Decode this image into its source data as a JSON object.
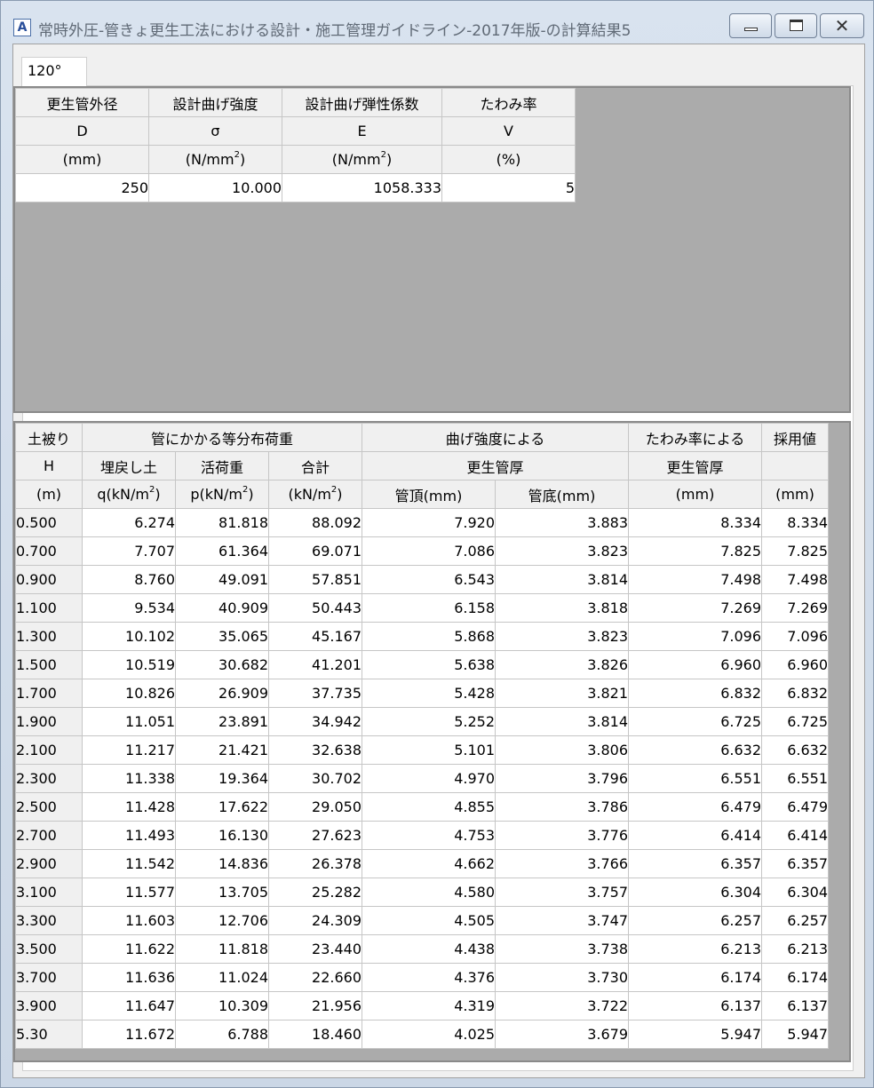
{
  "window": {
    "title": "常時外圧-管きょ更生工法における設計・施工管理ガイドライン-2017年版-の計算結果5",
    "icon": "app-a-icon",
    "close_glyph": "✕"
  },
  "tab": {
    "label": "120°"
  },
  "params": {
    "headers": [
      {
        "l1": "更生管外径",
        "l2": "D",
        "l3": "(mm)"
      },
      {
        "l1": "設計曲げ強度",
        "l2": "σ",
        "l3": "(N/mm²)"
      },
      {
        "l1": "設計曲げ弾性係数",
        "l2": "E",
        "l3": "(N/mm²)"
      },
      {
        "l1": "たわみ率",
        "l2": "V",
        "l3": "(%)"
      }
    ],
    "values": [
      "250",
      "10.000",
      "1058.333",
      "5"
    ]
  },
  "results": {
    "header": {
      "cover_l1": "土被り",
      "cover_l2": "H",
      "cover_l3": "(m)",
      "load_group": "管にかかる等分布荷重",
      "q_l1": "埋戻し土",
      "q_l2": "q(kN/m²)",
      "p_l1": "活荷重",
      "p_l2": "p(kN/m²)",
      "sum_l1": "合計",
      "sum_l2": "(kN/m²)",
      "bend_l1": "曲げ強度による",
      "bend_l2": "更生管厚",
      "top": "管頂(mm)",
      "bottom": "管底(mm)",
      "defl_l1": "たわみ率による",
      "defl_l2": "更生管厚",
      "defl_l3": "(mm)",
      "adopt_l1": "採用値",
      "adopt_l3": "(mm)"
    },
    "rows": [
      [
        "0.500",
        "6.274",
        "81.818",
        "88.092",
        "7.920",
        "3.883",
        "8.334",
        "8.334"
      ],
      [
        "0.700",
        "7.707",
        "61.364",
        "69.071",
        "7.086",
        "3.823",
        "7.825",
        "7.825"
      ],
      [
        "0.900",
        "8.760",
        "49.091",
        "57.851",
        "6.543",
        "3.814",
        "7.498",
        "7.498"
      ],
      [
        "1.100",
        "9.534",
        "40.909",
        "50.443",
        "6.158",
        "3.818",
        "7.269",
        "7.269"
      ],
      [
        "1.300",
        "10.102",
        "35.065",
        "45.167",
        "5.868",
        "3.823",
        "7.096",
        "7.096"
      ],
      [
        "1.500",
        "10.519",
        "30.682",
        "41.201",
        "5.638",
        "3.826",
        "6.960",
        "6.960"
      ],
      [
        "1.700",
        "10.826",
        "26.909",
        "37.735",
        "5.428",
        "3.821",
        "6.832",
        "6.832"
      ],
      [
        "1.900",
        "11.051",
        "23.891",
        "34.942",
        "5.252",
        "3.814",
        "6.725",
        "6.725"
      ],
      [
        "2.100",
        "11.217",
        "21.421",
        "32.638",
        "5.101",
        "3.806",
        "6.632",
        "6.632"
      ],
      [
        "2.300",
        "11.338",
        "19.364",
        "30.702",
        "4.970",
        "3.796",
        "6.551",
        "6.551"
      ],
      [
        "2.500",
        "11.428",
        "17.622",
        "29.050",
        "4.855",
        "3.786",
        "6.479",
        "6.479"
      ],
      [
        "2.700",
        "11.493",
        "16.130",
        "27.623",
        "4.753",
        "3.776",
        "6.414",
        "6.414"
      ],
      [
        "2.900",
        "11.542",
        "14.836",
        "26.378",
        "4.662",
        "3.766",
        "6.357",
        "6.357"
      ],
      [
        "3.100",
        "11.577",
        "13.705",
        "25.282",
        "4.580",
        "3.757",
        "6.304",
        "6.304"
      ],
      [
        "3.300",
        "11.603",
        "12.706",
        "24.309",
        "4.505",
        "3.747",
        "6.257",
        "6.257"
      ],
      [
        "3.500",
        "11.622",
        "11.818",
        "23.440",
        "4.438",
        "3.738",
        "6.213",
        "6.213"
      ],
      [
        "3.700",
        "11.636",
        "11.024",
        "22.660",
        "4.376",
        "3.730",
        "6.174",
        "6.174"
      ],
      [
        "3.900",
        "11.647",
        "10.309",
        "21.956",
        "4.319",
        "3.722",
        "6.137",
        "6.137"
      ],
      [
        "5.30",
        "11.672",
        "6.788",
        "18.460",
        "4.025",
        "3.679",
        "5.947",
        "5.947"
      ]
    ]
  }
}
